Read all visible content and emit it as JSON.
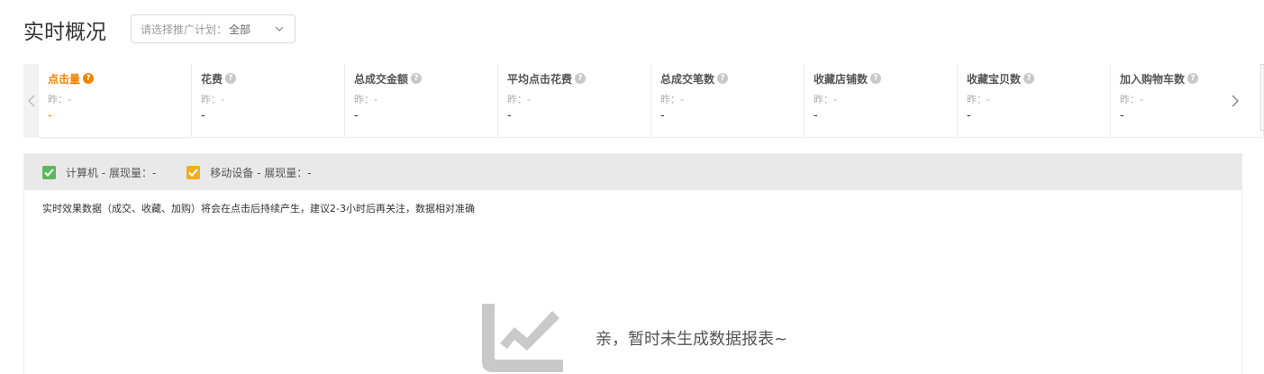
{
  "header": {
    "title": "实时概况",
    "plan_select": {
      "label": "请选择推广计划：",
      "value": "全部"
    }
  },
  "metrics": [
    {
      "name": "点击量",
      "yesterday": "昨：-",
      "value": "-",
      "active": true
    },
    {
      "name": "花费",
      "yesterday": "昨：-",
      "value": "-"
    },
    {
      "name": "总成交金额",
      "yesterday": "昨：-",
      "value": "-"
    },
    {
      "name": "平均点击花费",
      "yesterday": "昨：-",
      "value": "-"
    },
    {
      "name": "总成交笔数",
      "yesterday": "昨：-",
      "value": "-"
    },
    {
      "name": "收藏店铺数",
      "yesterday": "昨：-",
      "value": "-"
    },
    {
      "name": "收藏宝贝数",
      "yesterday": "昨：-",
      "value": "-"
    },
    {
      "name": "加入购物车数",
      "yesterday": "昨：-",
      "value": "-"
    }
  ],
  "help_glyph": "?",
  "chart_panel": {
    "legend": [
      {
        "label": "计算机 - 展现量：-",
        "color": "#5cb85c",
        "checked": true
      },
      {
        "label": "移动设备 - 展现量：-",
        "color": "#f0ad1e",
        "checked": true
      }
    ],
    "notice": "实时效果数据（成交、收藏、加购）将会在点击后持续产生，建议2-3小时后再关注，数据相对准确",
    "empty_message": "亲，暂时未生成数据报表~",
    "empty_icon": "chart-line-icon"
  },
  "colors": {
    "accent": "#f08300",
    "panel_header_bg": "#e9e9e9",
    "muted_icon": "#c8c8c8"
  }
}
